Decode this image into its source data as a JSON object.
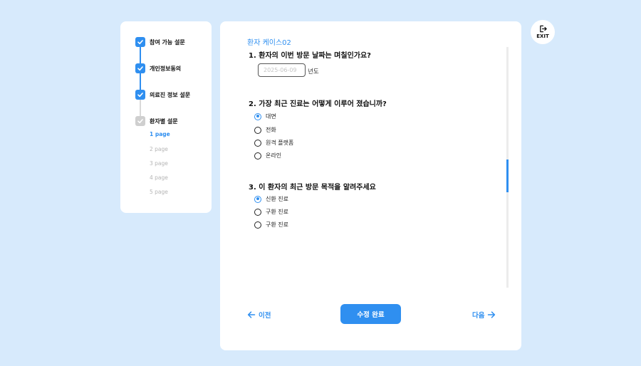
{
  "sidebar": {
    "steps": [
      {
        "label": "참여 가능 설문",
        "state": "done"
      },
      {
        "label": "개인정보동의",
        "state": "done"
      },
      {
        "label": "의료진 정보 설문",
        "state": "done"
      },
      {
        "label": "환자별 설문",
        "state": "current"
      }
    ],
    "pages": [
      "1 page",
      "2 page",
      "3 page",
      "4 page",
      "5 page"
    ],
    "active_page": "1 page"
  },
  "main": {
    "case_title": "환자 케이스02",
    "q1": {
      "title": "1. 환자의 이번 방문 날짜는 며칠인가요?",
      "placeholder": "2025-06-09",
      "suffix": "년도"
    },
    "q2": {
      "title": "2. 가장 최근 진료는 어떻게 이루어 졌습니까?",
      "options": [
        "대면",
        "전화",
        "원격 플랫폼",
        "온라인"
      ],
      "selected": "대면"
    },
    "q3": {
      "title": "3. 이 환자의 최근 방문 목적을 알려주세요",
      "options": [
        "신환 진료",
        "구환 진료",
        "구환 진료"
      ],
      "selected": "신환 진료"
    }
  },
  "footer": {
    "prev_label": "이전",
    "submit_label": "수정 완료",
    "next_label": "다음"
  },
  "exit": {
    "label": "EXIT"
  },
  "colors": {
    "accent": "#2f8ff0",
    "background": "#d7eafc"
  }
}
